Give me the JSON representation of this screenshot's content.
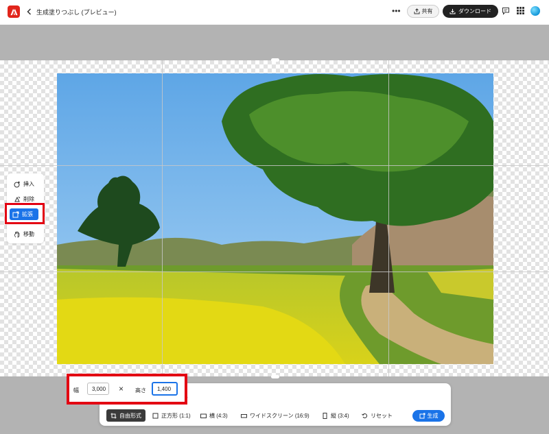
{
  "header": {
    "title": "生成塗りつぶし (プレビュー)",
    "more_label": "•••",
    "share_label": "共有",
    "download_label": "ダウンロード"
  },
  "tools": {
    "insert": "挿入",
    "remove": "削除",
    "expand": "拡張",
    "move": "移動"
  },
  "dimensions": {
    "width_label": "幅",
    "width_value": "3,000",
    "times": "×",
    "height_label": "高さ",
    "height_value": "1,400",
    "suffix": ")"
  },
  "presets": {
    "free": "自由形式",
    "square": "正方形 (1:1)",
    "landscape": "横 (4:3)",
    "widescreen": "ワイドスクリーン (16:9)",
    "portrait": "縦 (3:4)",
    "reset": "リセット"
  },
  "generate_label": "生成",
  "colors": {
    "accent": "#1a73e8",
    "highlight": "#e30012",
    "brand": "#e1251b"
  }
}
